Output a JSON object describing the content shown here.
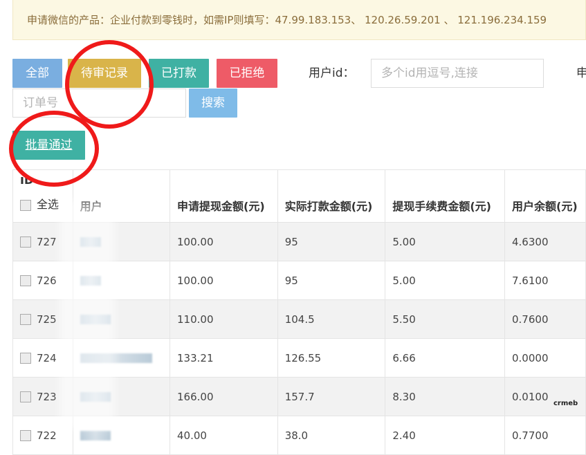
{
  "notice": {
    "text": "申请微信的产品：企业付款到零钱时，如需IP则填写：47.99.183.153、 120.26.59.201 、 121.196.234.159"
  },
  "filters": {
    "all_label": "全部",
    "pending_label": "待审记录",
    "paid_label": "已打款",
    "rejected_label": "已拒绝",
    "user_id_label": "用户id：",
    "user_id_placeholder": "多个id用逗号,连接",
    "right_cut_label": "申",
    "order_placeholder": "订单号",
    "search_label": "搜索"
  },
  "actions": {
    "batch_approve_label": "批量通过"
  },
  "table": {
    "id_header": "ID",
    "select_all_label": "全选",
    "headers": [
      "用户",
      "申请提现金额(元)",
      "实际打款金额(元)",
      "提现手续费金额(元)",
      "用户余额(元)"
    ],
    "rows": [
      {
        "id": "727",
        "amount": "100.00",
        "actual": "95",
        "fee": "5.00",
        "balance": "4.6300"
      },
      {
        "id": "726",
        "amount": "100.00",
        "actual": "95",
        "fee": "5.00",
        "balance": "7.6100"
      },
      {
        "id": "725",
        "amount": "110.00",
        "actual": "104.5",
        "fee": "5.50",
        "balance": "0.7600"
      },
      {
        "id": "724",
        "amount": "133.21",
        "actual": "126.55",
        "fee": "6.66",
        "balance": "0.0000"
      },
      {
        "id": "723",
        "amount": "166.00",
        "actual": "157.7",
        "fee": "8.30",
        "balance": "0.0100"
      },
      {
        "id": "722",
        "amount": "40.00",
        "actual": "38.0",
        "fee": "2.40",
        "balance": "0.7700"
      }
    ]
  },
  "watermark": "crmeb",
  "colors": {
    "notice_bg": "#fcf8e3",
    "btn_all": "#7aaee0",
    "btn_pending": "#d9b44a",
    "btn_paid": "#3fb1a3",
    "btn_rejected": "#ee5b67",
    "btn_search": "#7fbbe8",
    "annotation_circle": "#ef1a1a"
  }
}
